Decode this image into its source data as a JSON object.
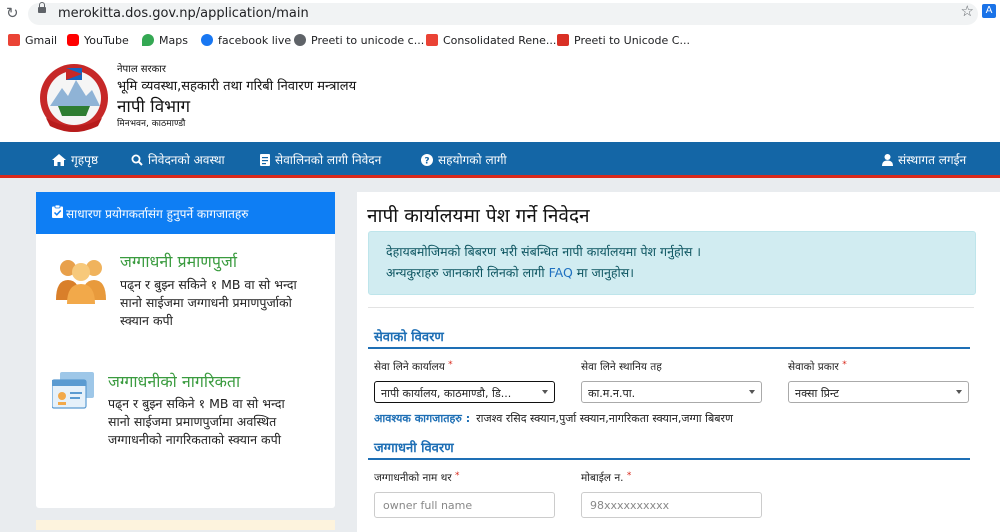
{
  "browser": {
    "url": "merokitta.dos.gov.np/application/main",
    "bookmarks": [
      {
        "label": "Gmail",
        "icon": "gmail-icon",
        "color": "#ea4335"
      },
      {
        "label": "YouTube",
        "icon": "youtube-icon",
        "color": "#ff0000"
      },
      {
        "label": "Maps",
        "icon": "maps-icon",
        "color": "#34a853"
      },
      {
        "label": "facebook live",
        "icon": "facebook-icon",
        "color": "#1877f2"
      },
      {
        "label": "Preeti to unicode c...",
        "icon": "globe-icon",
        "color": "#5f6368"
      },
      {
        "label": "Consolidated Rene...",
        "icon": "gmail-icon",
        "color": "#ea4335"
      },
      {
        "label": "Preeti to Unicode C...",
        "icon": "a-icon",
        "color": "#d93025"
      }
    ]
  },
  "header": {
    "gov_label": "नेपाल सरकार",
    "ministry": "भूमि व्यवस्था,सहकारी तथा गरिबी निवारण मन्त्रालय",
    "department": "नापी विभाग",
    "address": "मिनभवन, काठमाण्डौ"
  },
  "nav": {
    "home": "गृहपृष्ठ",
    "status": "निवेदनको अवस्था",
    "apply": "सेवालिनको लागी निवेदन",
    "help": "सहयोगको लागी",
    "login": "संस्थागत लगईन"
  },
  "sidebar": {
    "heading": "साधारण प्रयोगकर्तासंग हुनुपर्ने कागजातहरु",
    "items": [
      {
        "title": "जग्गाधनी प्रमाणपुर्जा",
        "desc": [
          "पढ्न र बुझ्न सकिने १ MB वा सो भन्दा",
          "सानो साईजमा जग्गाधनी प्रमाणपुर्जाको",
          "स्क्यान कपी"
        ]
      },
      {
        "title": "जग्गाधनीको नागरिकता",
        "desc": [
          "पढ्न र बुझ्न सकिने १ MB वा सो भन्दा",
          "सानो साईजमा प्रमाणपुर्जामा अवस्थित",
          "जग्गाधनीको नागरिकताको स्क्यान कपी"
        ]
      }
    ]
  },
  "main": {
    "title": "नापी कार्यालयमा पेश गर्ने निवेदन",
    "info_line1": "देहायबमोजिमको बिबरण भरी संबन्धित नापी कार्यालयमा पेश गर्नुहोस ।",
    "info_line2_pre": "अन्यकुराहरु जानकारी लिनको लागी",
    "info_faq": "FAQ",
    "info_line2_post": "मा जानुहोस।",
    "service_section": "सेवाको विवरण",
    "office_label": "सेवा लिने कार्यालय",
    "office_value": "नापी कार्यालय, काठमाण्डौ, डि...",
    "local_label": "सेवा लिने स्थानिय तह",
    "local_value": "का.म.न.पा.",
    "type_label": "सेवाको प्रकार",
    "type_value": "नक्सा प्रिन्ट",
    "req_docs_label": "आवश्यक कागजातहरु :",
    "req_docs_value": "राजश्व रसिद स्क्यान,पुर्जा स्क्यान,नागरिकता स्क्यान,जग्गा बिबरण",
    "owner_section": "जग्गाधनी विवरण",
    "owner_name_label": "जग्गाधनीको नाम थर",
    "owner_name_placeholder": "owner full name",
    "mobile_label": "मोबाईल न.",
    "mobile_placeholder": "98xxxxxxxxxx",
    "required_mark": "*"
  }
}
